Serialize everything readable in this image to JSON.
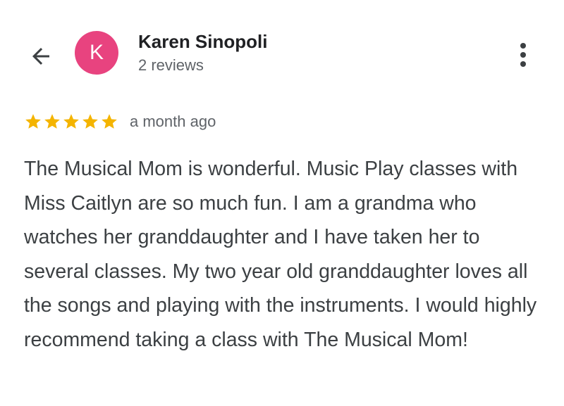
{
  "header": {
    "back_icon": "arrow-left-icon",
    "avatar": {
      "letter": "K",
      "color": "#e8437f"
    },
    "reviewer_name": "Karen Sinopoli",
    "reviews_count": "2 reviews",
    "more_icon": "more-vert-icon"
  },
  "review": {
    "rating": 5,
    "max_rating": 5,
    "star_color": "#f4b400",
    "date": "a month ago",
    "text": "The Musical Mom is wonderful. Music Play classes with Miss Caitlyn are so much fun. I am a grandma who watches her granddaughter and I have taken her to several classes. My two year old granddaughter loves all the songs and playing with the instruments. I would highly recommend taking a class with The Musical Mom!"
  }
}
